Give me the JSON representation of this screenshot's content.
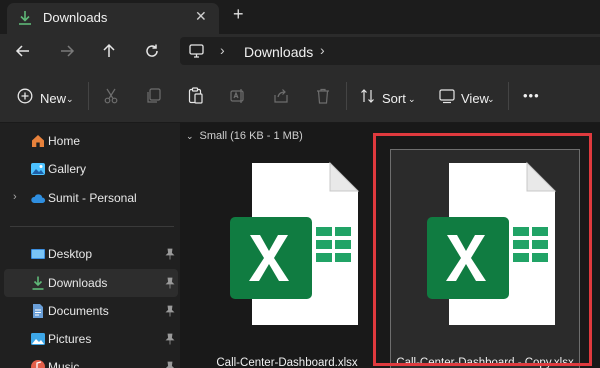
{
  "tab": {
    "title": "Downloads",
    "close_icon": "close-icon",
    "new_tab_icon": "plus-icon"
  },
  "address": {
    "location": "Downloads"
  },
  "toolbar": {
    "new_label": "New",
    "sort_label": "Sort",
    "view_label": "View",
    "more_label": "•••"
  },
  "sidebar": {
    "items": [
      {
        "label": "Home"
      },
      {
        "label": "Gallery"
      },
      {
        "label": "Sumit - Personal"
      },
      {
        "label": "Desktop"
      },
      {
        "label": "Downloads"
      },
      {
        "label": "Documents"
      },
      {
        "label": "Pictures"
      },
      {
        "label": "Music"
      }
    ]
  },
  "content": {
    "group_header": "Small (16 KB - 1 MB)",
    "files": [
      {
        "name": "Call-Center-Dashboard.xlsx"
      },
      {
        "name": "Call-Center-Dashboard - Copy.xlsx"
      }
    ]
  },
  "colors": {
    "accent": "#4cc2ff",
    "excel_green": "#107c41",
    "highlight_red": "#e03a3e",
    "download_green": "#5fb878"
  }
}
